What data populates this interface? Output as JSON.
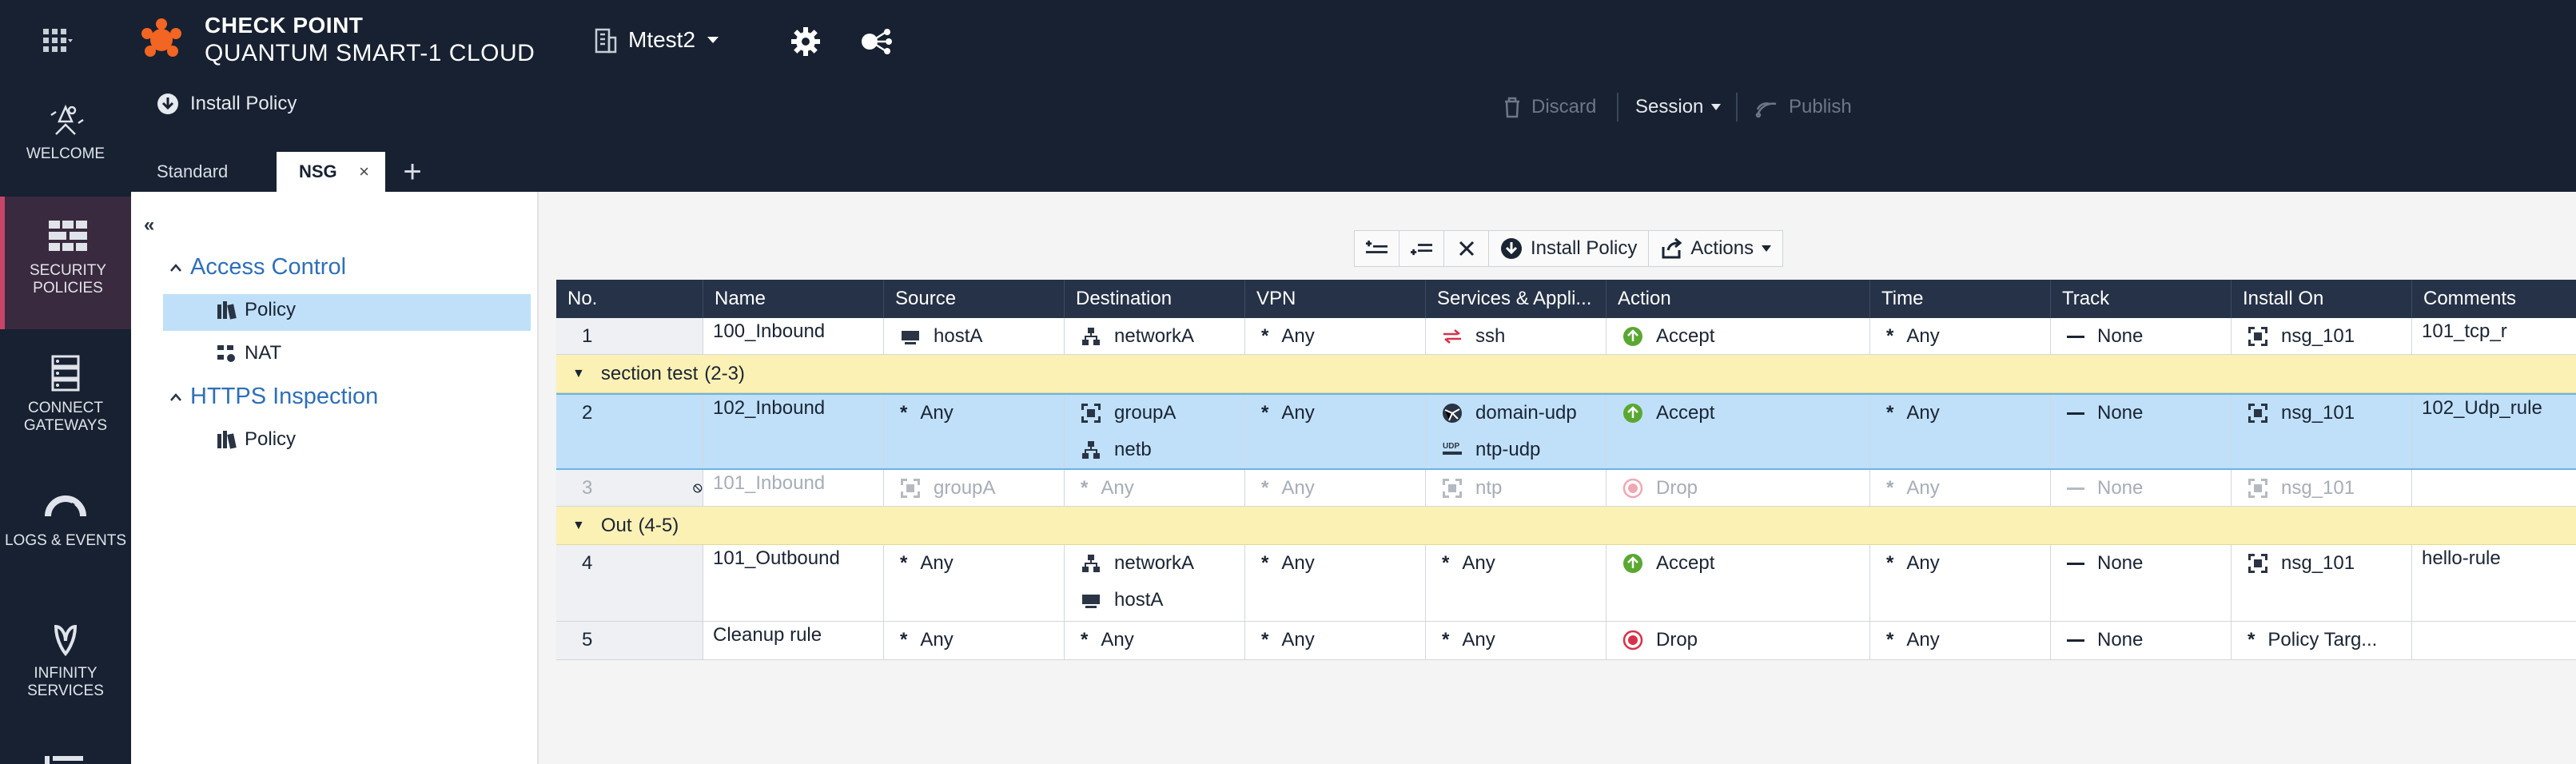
{
  "app": {
    "brand_line1": "CHECK POINT",
    "brand_line2": "QUANTUM SMART-1 CLOUD",
    "domain": "Mtest2"
  },
  "toolbar_top": {
    "install_policy": "Install Policy",
    "discard": "Discard",
    "session": "Session",
    "publish": "Publish"
  },
  "tabs": [
    {
      "label": "Standard"
    },
    {
      "label": "NSG"
    }
  ],
  "leftnav": [
    {
      "label": "WELCOME",
      "icon": "welcome-icon"
    },
    {
      "label": "SECURITY POLICIES",
      "icon": "security-policies-icon"
    },
    {
      "label": "CONNECT GATEWAYS",
      "icon": "gateways-icon"
    },
    {
      "label": "LOGS & EVENTS",
      "icon": "logs-icon"
    },
    {
      "label": "INFINITY SERVICES",
      "icon": "infinity-icon"
    }
  ],
  "tree": {
    "access_control": "Access Control",
    "access_policy": "Policy",
    "nat": "NAT",
    "https_inspection": "HTTPS Inspection",
    "https_policy": "Policy"
  },
  "rule_toolbar": {
    "install_policy": "Install Policy",
    "actions": "Actions"
  },
  "columns": [
    "No.",
    "Name",
    "Source",
    "Destination",
    "VPN",
    "Services & Appli...",
    "Action",
    "Time",
    "Track",
    "Install On",
    "Comments"
  ],
  "sections": [
    {
      "label": "section test",
      "range": "(2-3)"
    },
    {
      "label": "Out",
      "range": "(4-5)"
    }
  ],
  "rules": [
    {
      "no": "1",
      "name": "100_Inbound",
      "source": [
        "hostA"
      ],
      "destination": [
        "networkA"
      ],
      "vpn": "Any",
      "services": [
        "ssh"
      ],
      "action": "Accept",
      "time": "Any",
      "track": "None",
      "install_on": "nsg_101",
      "comments": "101_tcp_r"
    },
    {
      "no": "2",
      "name": "102_Inbound",
      "source": [
        "Any"
      ],
      "destination": [
        "groupA",
        "netb"
      ],
      "vpn": "Any",
      "services": [
        "domain-udp",
        "ntp-udp"
      ],
      "action": "Accept",
      "time": "Any",
      "track": "None",
      "install_on": "nsg_101",
      "comments": "102_Udp_rule"
    },
    {
      "no": "3",
      "name": "101_Inbound",
      "source": [
        "groupA"
      ],
      "destination": [
        "Any"
      ],
      "vpn": "Any",
      "services": [
        "ntp"
      ],
      "action": "Drop",
      "time": "Any",
      "track": "None",
      "install_on": "nsg_101",
      "comments": ""
    },
    {
      "no": "4",
      "name": "101_Outbound",
      "source": [
        "Any"
      ],
      "destination": [
        "networkA",
        "hostA"
      ],
      "vpn": "Any",
      "services": [
        "Any"
      ],
      "action": "Accept",
      "time": "Any",
      "track": "None",
      "install_on": "nsg_101",
      "comments": "hello-rule"
    },
    {
      "no": "5",
      "name": "Cleanup rule",
      "source": [
        "Any"
      ],
      "destination": [
        "Any"
      ],
      "vpn": "Any",
      "services": [
        "Any"
      ],
      "action": "Drop",
      "time": "Any",
      "track": "None",
      "install_on": "Policy Targ...",
      "comments": ""
    }
  ],
  "colors": {
    "nav_bg": "#172131",
    "accept": "#5aa832",
    "drop": "#d6324a",
    "section_bg": "#fcf1b4",
    "selected_row": "#bfe0f8",
    "link_blue": "#2e6fb7",
    "logo_orange": "#f26522"
  }
}
